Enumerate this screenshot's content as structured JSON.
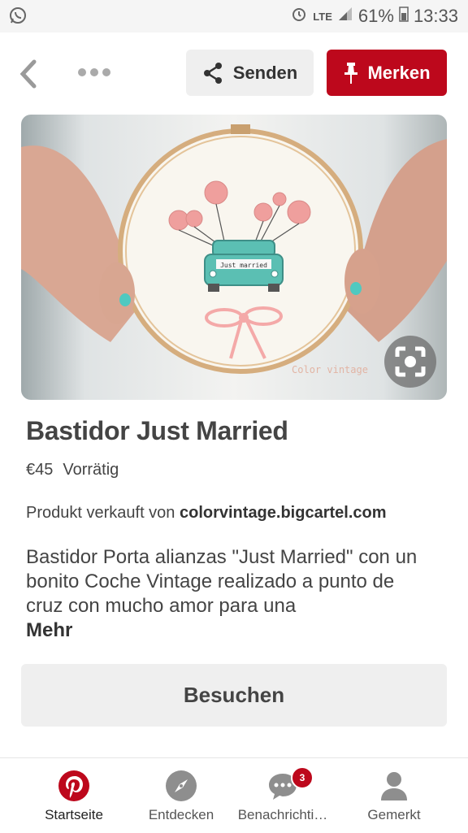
{
  "status_bar": {
    "network": "LTE",
    "battery": "61%",
    "time": "13:33"
  },
  "header": {
    "send_label": "Senden",
    "save_label": "Merken"
  },
  "pin": {
    "image_watermark": "Color vintage",
    "title": "Bastidor Just Married",
    "price": "€45",
    "stock": "Vorrätig",
    "seller_prefix": "Produkt verkauft von ",
    "seller_domain": "colorvintage.bigcartel.com",
    "description": "Bastidor Porta alianzas \"Just Married\" con un bonito Coche Vintage realizado a punto de cruz con mucho amor para una",
    "more_label": "Mehr",
    "visit_label": "Besuchen"
  },
  "nav": {
    "items": [
      {
        "label": "Startseite",
        "icon": "pinterest-icon"
      },
      {
        "label": "Entdecken",
        "icon": "compass-icon"
      },
      {
        "label": "Benachrichti…",
        "icon": "chat-icon",
        "badge": "3"
      },
      {
        "label": "Gemerkt",
        "icon": "person-icon"
      }
    ]
  },
  "colors": {
    "brand_red": "#bd081c",
    "button_gray": "#efefef",
    "accent_teal": "#4fb8ad"
  }
}
